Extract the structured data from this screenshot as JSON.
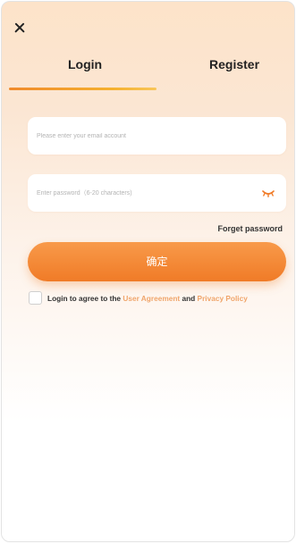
{
  "header": {
    "close_icon": "close-icon"
  },
  "tabs": [
    {
      "label": "Login",
      "active": true
    },
    {
      "label": "Register",
      "active": false
    }
  ],
  "form": {
    "email_placeholder": "Please enter your email account",
    "password_placeholder": "Enter password（6-20 characters)",
    "password_toggle_icon": "eye-closed-icon",
    "forget_password_label": "Forget password",
    "confirm_label": "确定"
  },
  "agreement": {
    "prefix": "Login to agree to the ",
    "user_agreement_label": "User Agreement",
    "conjunction": " and ",
    "privacy_policy_label": "Privacy Policy"
  },
  "colors": {
    "accent": "#f07b27",
    "link": "#f0a56b",
    "background_top": "#fde3c9"
  }
}
